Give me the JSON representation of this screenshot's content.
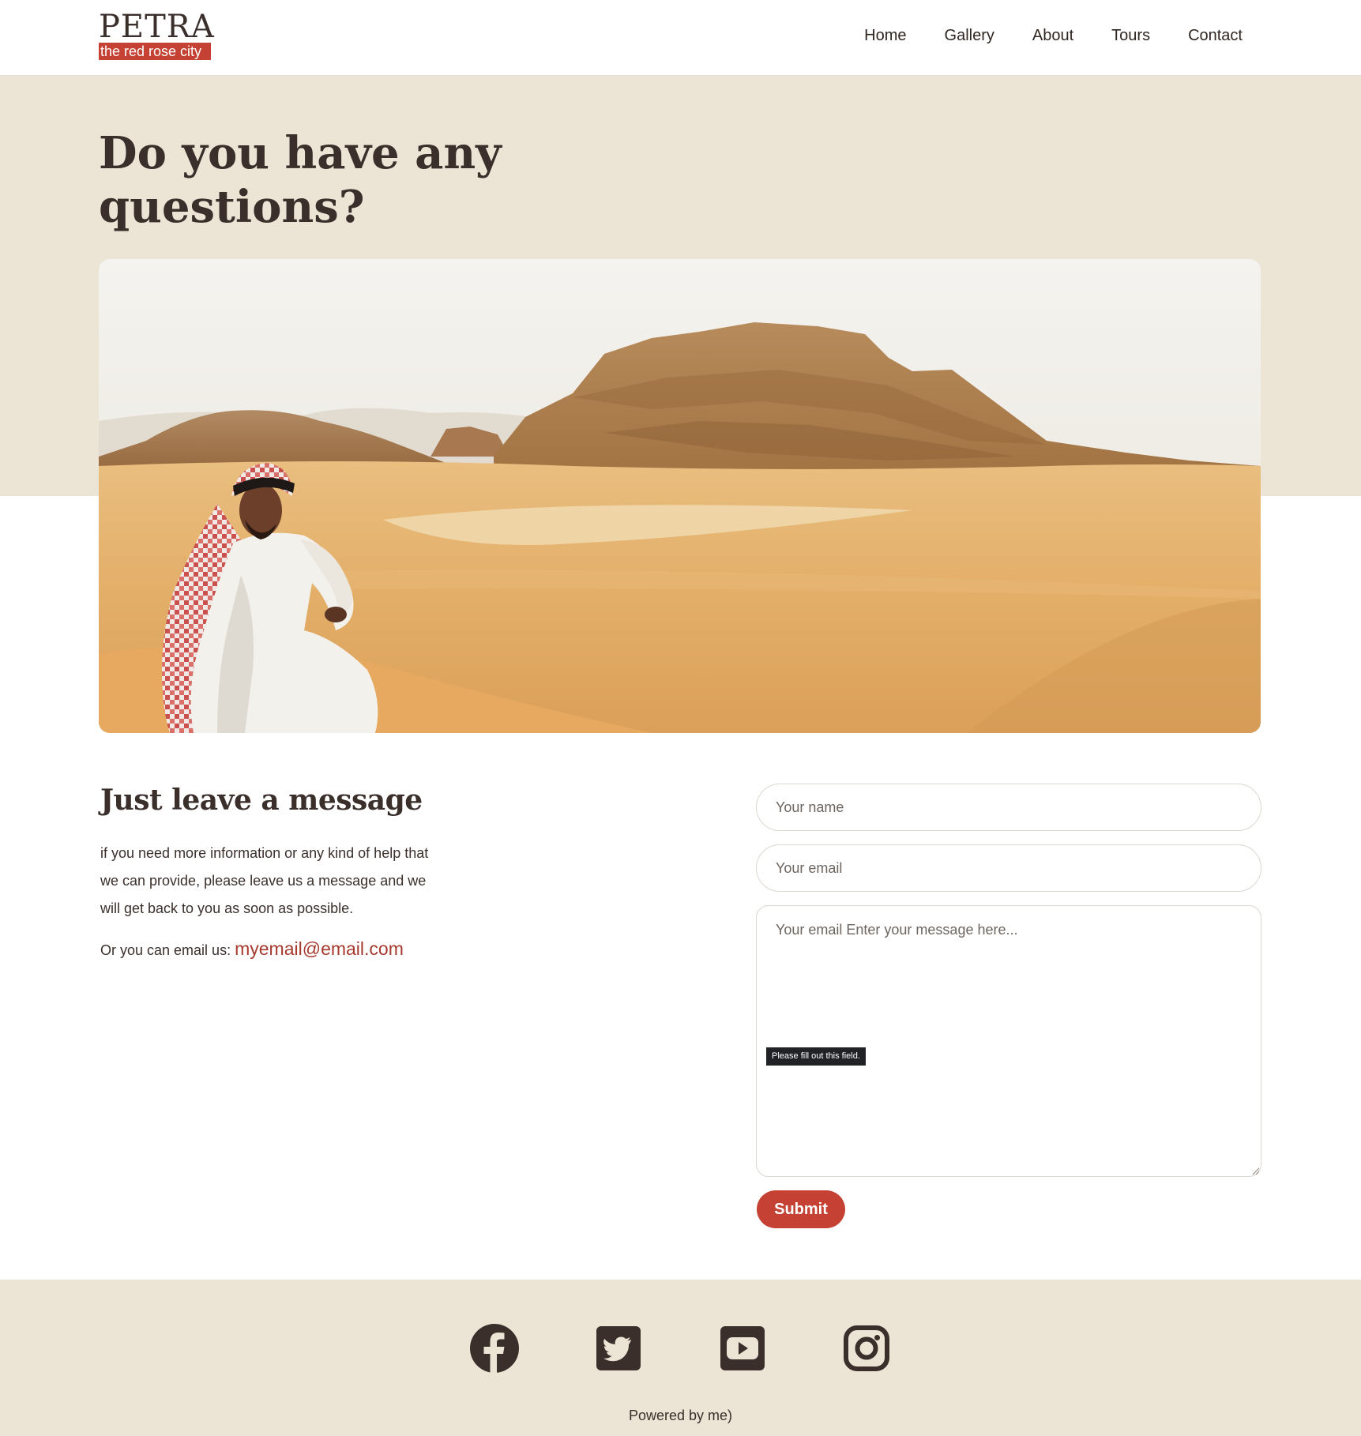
{
  "header": {
    "logo_title": "PETRA",
    "logo_tagline": "the red rose city",
    "nav": [
      "Home",
      "Gallery",
      "About",
      "Tours",
      "Contact"
    ]
  },
  "hero": {
    "title": "Do you have any questions?",
    "image_subject": "desert-landscape-with-seated-man"
  },
  "message_section": {
    "title": "Just leave a message",
    "body": "if you need more information or any kind of help that we can provide, please leave us a message and we will get back to you as soon as possible.",
    "email_prefix": "Or you can email us:",
    "email": "myemail@email.com"
  },
  "form": {
    "name_placeholder": "Your name",
    "email_placeholder": "Your email",
    "message_placeholder": "Your email Enter your message here...",
    "validation_tooltip": "Please fill out this field.",
    "submit_label": "Submit"
  },
  "footer": {
    "social_icons": [
      "facebook-icon",
      "twitter-icon",
      "youtube-icon",
      "instagram-icon"
    ],
    "powered_by": "Powered by me)"
  },
  "colors": {
    "accent": "#c44133",
    "beige": "#ece4d4",
    "text": "#3a2f2b",
    "link": "#a63a2e"
  }
}
